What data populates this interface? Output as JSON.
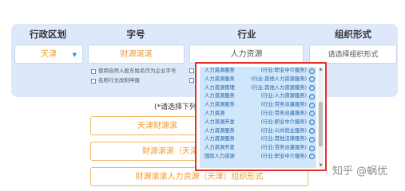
{
  "columns": {
    "region": "行政区划",
    "name": "字号",
    "industry": "行业",
    "org_form": "组织形式"
  },
  "fields": {
    "region_value": "天津",
    "name_value": "财源滚滚",
    "industry_value": "人力资源",
    "org_form_placeholder": "请选择组织形式"
  },
  "checkboxes": [
    {
      "label": "使用自然人股东姓名作为企业字号",
      "checked": false
    },
    {
      "label": "名称行文改制申报",
      "checked": false
    }
  ],
  "prompt": "(*请选择下列一",
  "results": [
    "天津财源滚",
    "财源滚滚（天津",
    "财源滚滚人力资源（天津）组织形式"
  ],
  "dropdown": {
    "items": [
      {
        "name": "人力资源服务",
        "category": "(行业:职业中介服务)"
      },
      {
        "name": "人力资源服务",
        "category": "(行业:其他人力资源服务)"
      },
      {
        "name": "人力资源管理",
        "category": "(行业:其他人力资源服务)"
      },
      {
        "name": "人力资源服务",
        "category": "(行业:人力资源服务)"
      },
      {
        "name": "人力资源服务",
        "category": "(行业:劳务派遣服务)"
      },
      {
        "name": "人力资源",
        "category": "(行业:劳务派遣服务)"
      },
      {
        "name": "人力资源开发",
        "category": "(行业:职业中介服务)"
      },
      {
        "name": "人力资源服务",
        "category": "(行业:公共就业服务)"
      },
      {
        "name": "人力资源服务",
        "category": "(行业:其他法律服务)"
      },
      {
        "name": "人力资源开发",
        "category": "(行业:劳务派遣服务)"
      },
      {
        "name": "国际人力资源",
        "category": "(行业:职业中介服务)"
      }
    ],
    "arrow_icon": "chevron-right-circle-icon"
  },
  "watermark": "知乎 @蜗优",
  "colors": {
    "panel_bg": "#dde9fb",
    "accent_orange": "#f39a2c",
    "highlight_red": "#e2322b",
    "dropdown_bg": "#cfe6fb"
  }
}
